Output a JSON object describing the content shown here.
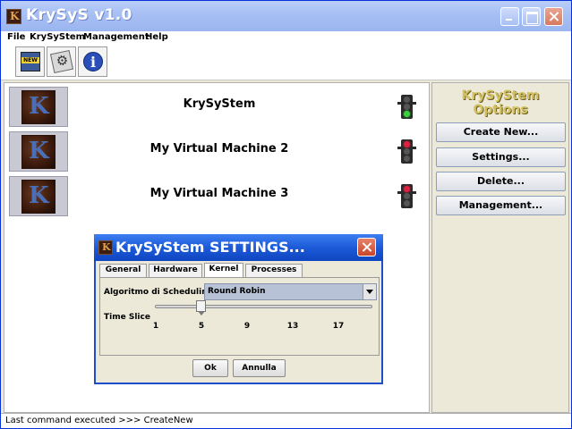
{
  "window": {
    "title": "KrySyS v1.0"
  },
  "menu": {
    "items": [
      "File",
      "KrySyStem",
      "Management",
      "Help"
    ]
  },
  "toolbar": {
    "buttons": [
      "new-machine-icon",
      "settings-icon",
      "info-icon"
    ]
  },
  "vms": [
    {
      "name": "KrySyStem",
      "state": "green"
    },
    {
      "name": "My Virtual Machine 2",
      "state": "red"
    },
    {
      "name": "My Virtual Machine 3",
      "state": "red"
    }
  ],
  "options": {
    "title": "KrySyStem Options",
    "buttons": [
      "Create New...",
      "Settings...",
      "Delete...",
      "Management..."
    ]
  },
  "status": {
    "text": "Last command executed >>> CreateNew"
  },
  "dialog": {
    "title": "KrySyStem SETTINGS...",
    "tabs": [
      "General",
      "Hardware",
      "Kernel",
      "Processes"
    ],
    "active_tab": "Kernel",
    "scheduling_label": "Algoritmo di Scheduling",
    "scheduling_value": "Round Robin",
    "time_slice_label": "Time Slice",
    "time_slice_ticks": [
      "1",
      "5",
      "9",
      "13",
      "17"
    ],
    "time_slice_value": 5,
    "time_slice_min": 1,
    "time_slice_max": 20,
    "ok_label": "Ok",
    "cancel_label": "Annulla"
  }
}
